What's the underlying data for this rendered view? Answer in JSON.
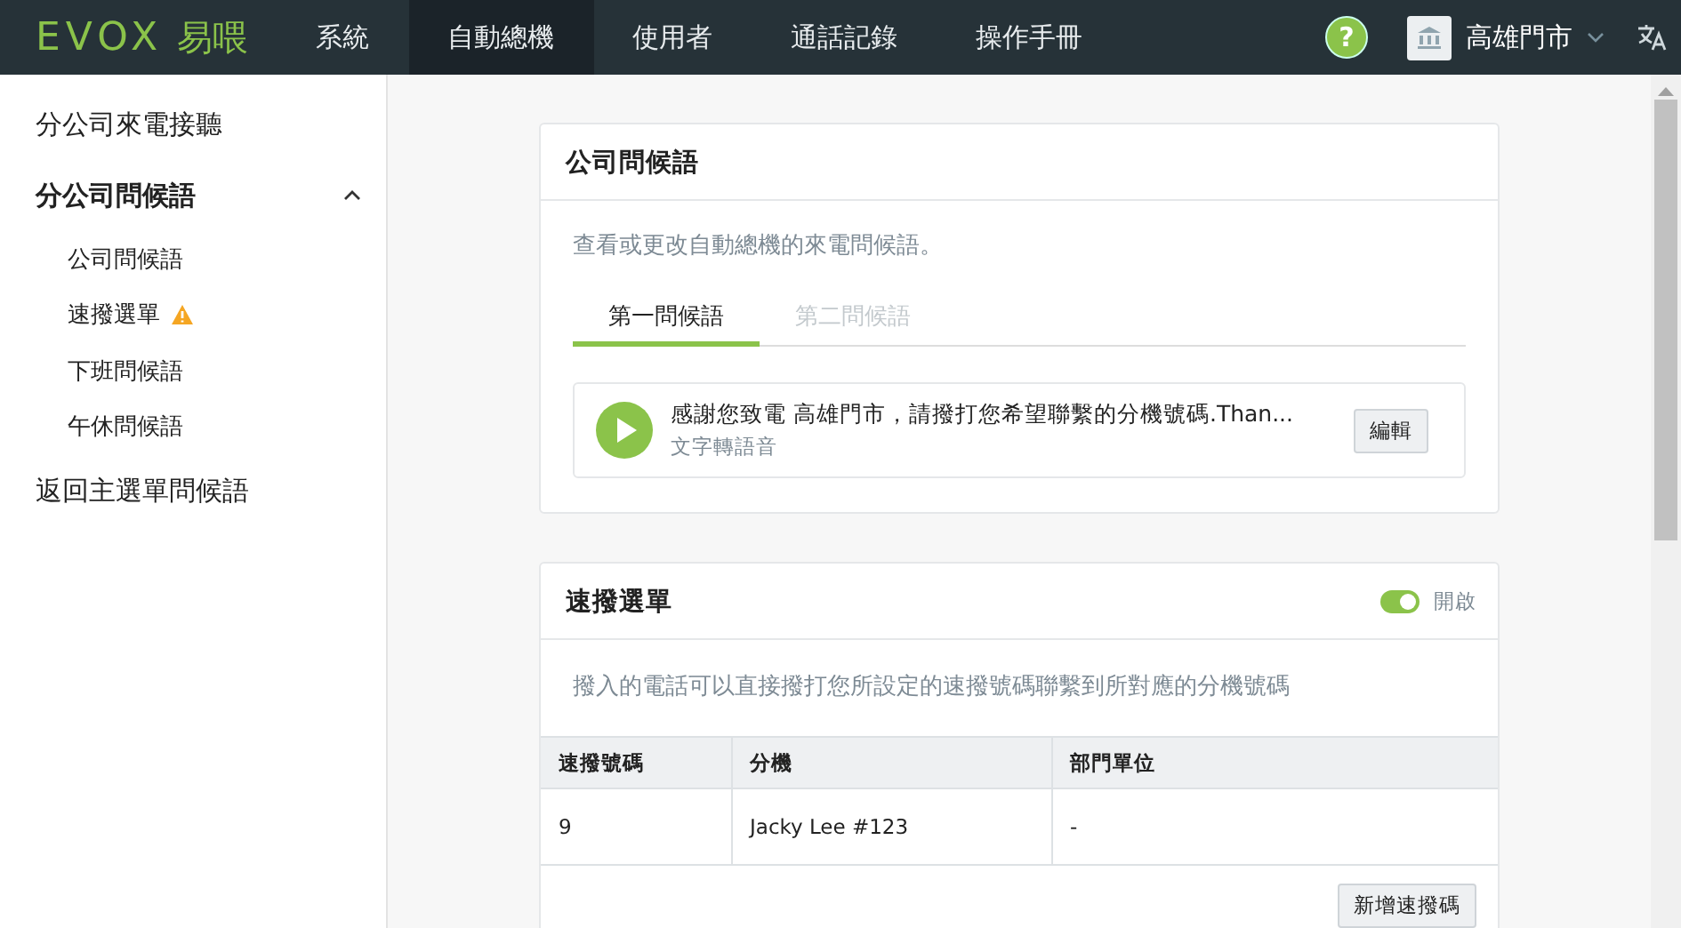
{
  "logo": {
    "mark": "EVOX",
    "name": "易喂"
  },
  "nav": [
    {
      "label": "系統",
      "selected": false
    },
    {
      "label": "自動總機",
      "selected": true
    },
    {
      "label": "使用者",
      "selected": false
    },
    {
      "label": "通話記錄",
      "selected": false
    },
    {
      "label": "操作手冊",
      "selected": false
    }
  ],
  "help": "?",
  "store": {
    "label": "高雄門市"
  },
  "sidebar": {
    "items": [
      {
        "label": "分公司來電接聽"
      },
      {
        "label": "分公司問候語",
        "expanded": true,
        "children": [
          {
            "label": "公司問候語",
            "warning": false
          },
          {
            "label": "速撥選單",
            "warning": true
          },
          {
            "label": "下班問候語",
            "warning": false
          },
          {
            "label": "午休問候語",
            "warning": false
          }
        ]
      },
      {
        "label": "返回主選單問候語"
      }
    ]
  },
  "greeting_card": {
    "title": "公司問候語",
    "description": "查看或更改自動總機的來電問候語。",
    "tabs": [
      {
        "label": "第一問候語",
        "selected": true
      },
      {
        "label": "第二問候語",
        "selected": false
      }
    ],
    "greeting": {
      "text": "感謝您致電 高雄門市，請撥打您希望聯繫的分機號碼.Than...",
      "type": "文字轉語音"
    },
    "edit_button": "編輯"
  },
  "speed_dial_card": {
    "title": "速撥選單",
    "enabled": true,
    "toggle_label": "開啟",
    "description": "撥入的電話可以直接撥打您所設定的速撥號碼聯繫到所對應的分機號碼",
    "table": {
      "columns": [
        "速撥號碼",
        "分機",
        "部門單位"
      ],
      "rows": [
        [
          "9",
          "Jacky Lee #123",
          "-"
        ]
      ]
    },
    "add_button": "新增速撥碼"
  }
}
